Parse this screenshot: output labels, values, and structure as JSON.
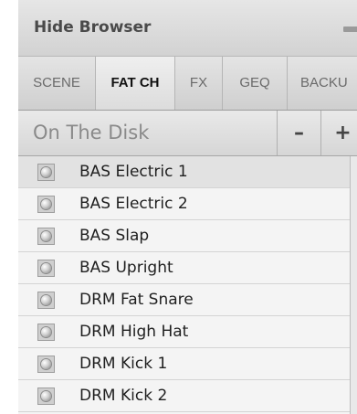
{
  "header": {
    "title": "Hide Browser"
  },
  "tabs": [
    {
      "label": "SCENE",
      "active": false
    },
    {
      "label": "FAT CH",
      "active": true
    },
    {
      "label": "FX",
      "active": false
    },
    {
      "label": "GEQ",
      "active": false
    },
    {
      "label": "BACKU",
      "active": false
    }
  ],
  "source": {
    "label": "On The Disk",
    "minus_label": "–",
    "plus_label": "+"
  },
  "items": [
    {
      "label": "BAS Electric 1",
      "selected": true
    },
    {
      "label": "BAS Electric 2",
      "selected": false
    },
    {
      "label": "BAS Slap",
      "selected": false
    },
    {
      "label": "BAS Upright",
      "selected": false
    },
    {
      "label": "DRM Fat Snare",
      "selected": false
    },
    {
      "label": "DRM High Hat",
      "selected": false
    },
    {
      "label": "DRM Kick 1",
      "selected": false
    },
    {
      "label": "DRM Kick 2",
      "selected": false
    }
  ],
  "icons": {
    "item_icon": "preset-file-icon",
    "minimize_icon": "minimize-icon"
  },
  "colors": {
    "selected_row": "#e2e2e2",
    "row_background": "#f4f4f4",
    "active_tab_text": "#111111",
    "inactive_tab_text": "#6a6a6a"
  }
}
